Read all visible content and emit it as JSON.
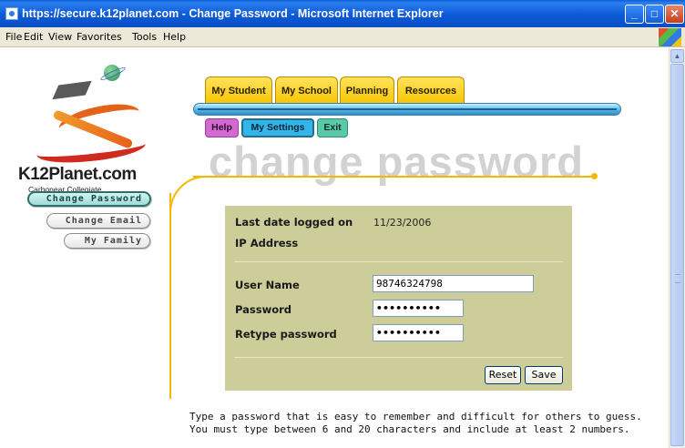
{
  "window": {
    "title": "https://secure.k12planet.com - Change Password - Microsoft Internet Explorer",
    "minimize_glyph": "_",
    "maximize_glyph": "□",
    "close_glyph": "✕"
  },
  "menubar": {
    "items": [
      "File",
      "Edit",
      "View",
      "Favorites",
      "Tools",
      "Help"
    ]
  },
  "logo": {
    "brand": "K12Planet.com",
    "school": "Carbonear Collegiate"
  },
  "leftnav": {
    "items": [
      "Change Password",
      "Change Email",
      "My Family"
    ],
    "active": "Change Password"
  },
  "tabs": {
    "main": [
      "My Student",
      "My School",
      "Planning",
      "Resources"
    ],
    "sub": [
      "Help",
      "My Settings",
      "Exit"
    ],
    "active_sub": "My Settings"
  },
  "page": {
    "heading": "change password"
  },
  "form": {
    "last_login_label": "Last date logged on",
    "last_login_value": "11/23/2006",
    "ip_label": "IP Address",
    "ip_value": "",
    "username_label": "User Name",
    "username_value": "98746324798",
    "password_label": "Password",
    "password_value": "••••••••••",
    "retype_label": "Retype password",
    "retype_value": "••••••••••",
    "reset_label": "Reset",
    "save_label": "Save"
  },
  "help": {
    "line1": "Type a password that is easy to remember and difficult for others to guess.",
    "line2": "You must type between 6 and 20 characters and include at least 2 numbers."
  },
  "colors": {
    "tab_yellow": "#f7c400",
    "panel_olive": "#cccd99",
    "accent_gold": "#f4b800",
    "bar_blue": "#2b8ec8"
  },
  "icons": [
    "ie-icon",
    "windows-flag-icon",
    "scroll-up-arrow-icon",
    "mortarboard-icon",
    "planet-icon"
  ]
}
